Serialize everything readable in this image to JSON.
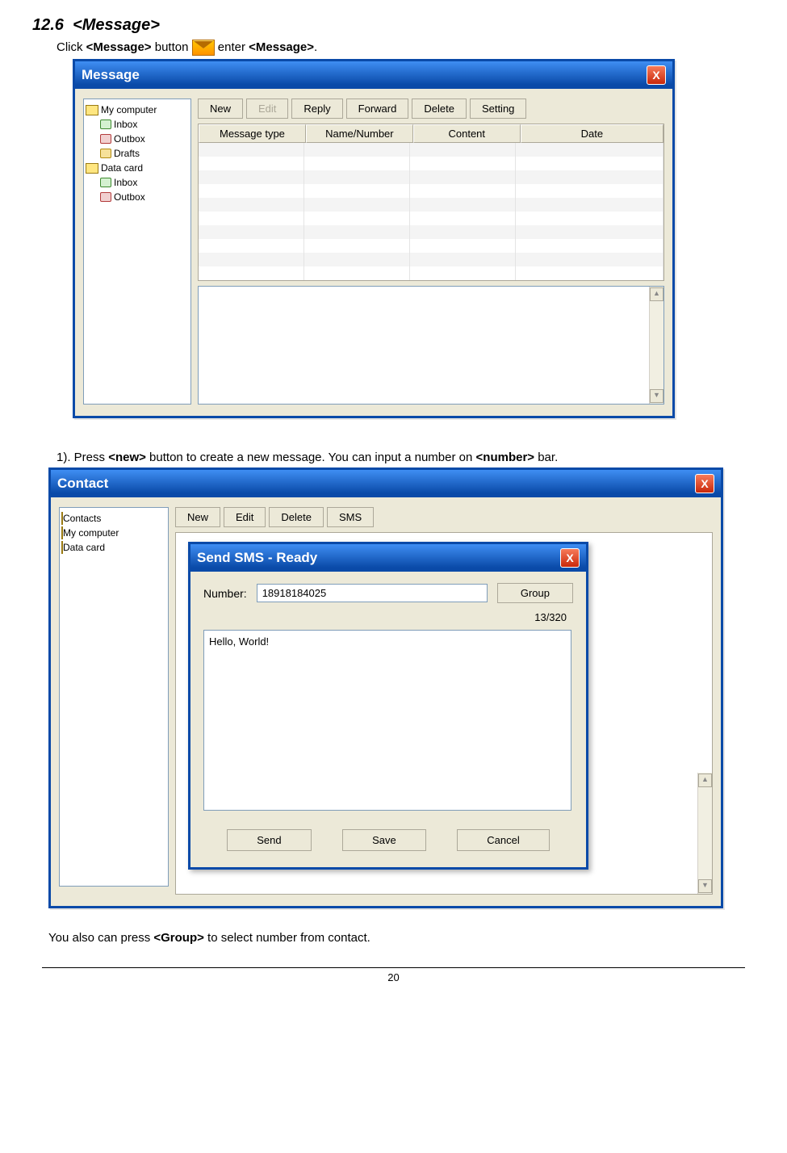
{
  "section": {
    "number": "12.6",
    "title": "<Message>"
  },
  "intro": {
    "pre": "Click ",
    "b1": "<Message>",
    "mid": " button ",
    "post": " enter ",
    "b2": "<Message>",
    "end": "."
  },
  "messageWin": {
    "title": "Message",
    "closeGlyph": "X",
    "tree": {
      "root1": "My computer",
      "r1_inbox": "Inbox",
      "r1_outbox": "Outbox",
      "r1_drafts": "Drafts",
      "root2": "Data card",
      "r2_inbox": "Inbox",
      "r2_outbox": "Outbox"
    },
    "toolbar": {
      "new": "New",
      "edit": "Edit",
      "reply": "Reply",
      "forward": "Forward",
      "delete": "Delete",
      "setting": "Setting"
    },
    "columns": {
      "c1": "Message type",
      "c2": "Name/Number",
      "c3": "Content",
      "c4": "Date"
    }
  },
  "step1": {
    "pre": "1). Press ",
    "b1": "<new>",
    "mid": " button to create a new message. You can input a number on ",
    "b2": "<number>",
    "end": " bar."
  },
  "contactWin": {
    "title": "Contact",
    "tree": {
      "root": "Contacts",
      "c1": "My computer",
      "c2": "Data card"
    },
    "toolbar": {
      "new": "New",
      "edit": "Edit",
      "delete": "Delete",
      "sms": "SMS"
    }
  },
  "sendSms": {
    "title": "Send SMS - Ready",
    "numberLabel": "Number:",
    "numberValue": "18918184025",
    "group": "Group",
    "counter": "13/320",
    "body": "Hello, World!",
    "send": "Send",
    "save": "Save",
    "cancel": "Cancel"
  },
  "footnote": {
    "pre": "You also can press ",
    "b1": "<Group>",
    "post": " to select number from contact."
  },
  "pageNumber": "20",
  "scroll": {
    "up": "▲",
    "down": "▼"
  }
}
